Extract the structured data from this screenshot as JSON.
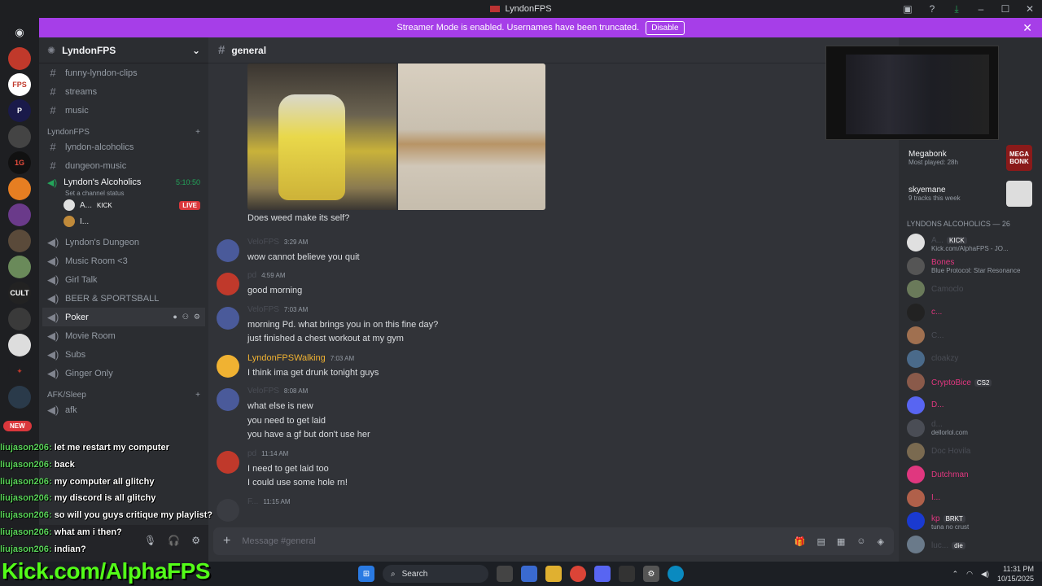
{
  "window": {
    "title": "LyndonFPS"
  },
  "banner": {
    "text": "Streamer Mode is enabled. Usernames have been truncated.",
    "disable": "Disable"
  },
  "server": {
    "name": "LyndonFPS"
  },
  "channels_top": [
    {
      "name": "funny-lyndon-clips",
      "icon": "hash-icon"
    },
    {
      "name": "streams",
      "icon": "hash-icon"
    },
    {
      "name": "music",
      "icon": "hash-icon"
    }
  ],
  "category1": "LyndonFPS",
  "text_channels": [
    {
      "name": "lyndon-alcoholics"
    },
    {
      "name": "dungeon-music"
    }
  ],
  "active_voice": {
    "name": "Lyndon's Alcoholics",
    "timer": "5:10:50",
    "status": "Set a channel status",
    "users": [
      {
        "name": "A...",
        "tag": "KICK",
        "live": "LIVE"
      },
      {
        "name": "I..."
      }
    ]
  },
  "voice_channels": [
    {
      "name": "Lyndon's Dungeon"
    },
    {
      "name": "Music Room <3"
    },
    {
      "name": "Girl Talk"
    },
    {
      "name": "BEER & SPORTSBALL"
    },
    {
      "name": "Poker"
    },
    {
      "name": "Movie Room"
    },
    {
      "name": "Subs"
    },
    {
      "name": "Ginger Only"
    }
  ],
  "category2": "AFK/Sleep",
  "afk_channel": "afk",
  "new_badge": "NEW",
  "overlay_chat": [
    {
      "user": "liujason206:",
      "text": " let me restart my computer"
    },
    {
      "user": "liujason206:",
      "text": " back"
    },
    {
      "user": "liujason206:",
      "text": " my computer all glitchy"
    },
    {
      "user": "liujason206:",
      "text": " my discord is all glitchy"
    },
    {
      "user": "liujason206:",
      "text": " so will you guys critique my playlist?"
    },
    {
      "user": "liujason206:",
      "text": " what am i then?"
    },
    {
      "user": "liujason206:",
      "text": " indian?"
    }
  ],
  "kick_url": "Kick.com/AlphaFPS",
  "channel": {
    "name": "general"
  },
  "messages": [
    {
      "author": "",
      "time": "",
      "lines": [
        "Does weed make its self?"
      ],
      "avatar_color": ""
    },
    {
      "author": "VeloFPS",
      "time": "3:29 AM",
      "lines": [
        "wow cannot believe you quit"
      ],
      "avatar_color": "#4a5a9a"
    },
    {
      "author": "pd",
      "time": "4:59 AM",
      "lines": [
        "good morning"
      ],
      "avatar_color": "#c0392b"
    },
    {
      "author": "VeloFPS",
      "time": "7:03 AM",
      "lines": [
        "morning Pd. what brings you in on this fine day?",
        "just finished a chest workout at my gym"
      ],
      "avatar_color": "#4a5a9a"
    },
    {
      "author": "LyndonFPSWalking",
      "time": "7:03 AM",
      "lines": [
        "I think ima get drunk tonight guys"
      ],
      "avatar_color": "#f0b232",
      "gold": true
    },
    {
      "author": "VeloFPS",
      "time": "8:08 AM",
      "lines": [
        "what else is new",
        "you need to get laid",
        "you have a gf but don't use her"
      ],
      "avatar_color": "#4a5a9a"
    },
    {
      "author": "pd",
      "time": "11:14 AM",
      "lines": [
        "I need to get laid too",
        "I could use some hole rn!"
      ],
      "avatar_color": "#c0392b"
    },
    {
      "author": "F...",
      "time": "11:15 AM",
      "lines": [],
      "avatar_color": "#3a3c42"
    }
  ],
  "composer": {
    "placeholder": "Message #general"
  },
  "activities": [
    {
      "title": "Megabonk",
      "sub": "Most played: 28h",
      "thumb": "MEGA BONK"
    },
    {
      "title": "skyemane",
      "sub": "9 tracks this week",
      "thumb": ""
    }
  ],
  "members_header": "LYNDONS ALCOHOLICS — 26",
  "members": [
    {
      "name": "A...",
      "sub": "Kick.com/AlphaFPS - JO...",
      "tag": "KICK",
      "color": "#e0e0e0",
      "pink": false
    },
    {
      "name": "Bones",
      "sub": "Blue Protocol: Star Resonance",
      "color": "#555",
      "pink": true
    },
    {
      "name": "Camoclo",
      "sub": "",
      "color": "#6a7a5a",
      "pink": false
    },
    {
      "name": "c...",
      "sub": "",
      "color": "#222",
      "pink": true
    },
    {
      "name": "C...",
      "sub": "",
      "color": "#a07050",
      "pink": false
    },
    {
      "name": "cloakzy",
      "sub": "",
      "color": "#4a6a8a",
      "pink": false
    },
    {
      "name": "CryptoBice",
      "tag": "CS2",
      "sub": "",
      "color": "#8a5a4a",
      "pink": true
    },
    {
      "name": "D...",
      "sub": "",
      "color": "#5865f2",
      "pink": true
    },
    {
      "name": "d...",
      "sub": "dellorlol.com",
      "color": "#4a4d55",
      "pink": false
    },
    {
      "name": "Doc Hovila",
      "sub": "",
      "color": "#7a6a50",
      "pink": false
    },
    {
      "name": "Dutchman",
      "sub": "",
      "color": "#e0377f",
      "pink": true
    },
    {
      "name": "I...",
      "sub": "",
      "color": "#b0604a",
      "pink": true
    },
    {
      "name": "kp",
      "tag": "BRKT",
      "sub": "tuna no crust",
      "color": "#1a3ad0",
      "pink": true
    },
    {
      "name": "luc...",
      "tag": "die",
      "sub": "",
      "color": "#6a7a8a",
      "pink": false
    }
  ],
  "taskbar": {
    "search": "Search",
    "time": "11:31 PM",
    "date": "10/15/2025"
  }
}
